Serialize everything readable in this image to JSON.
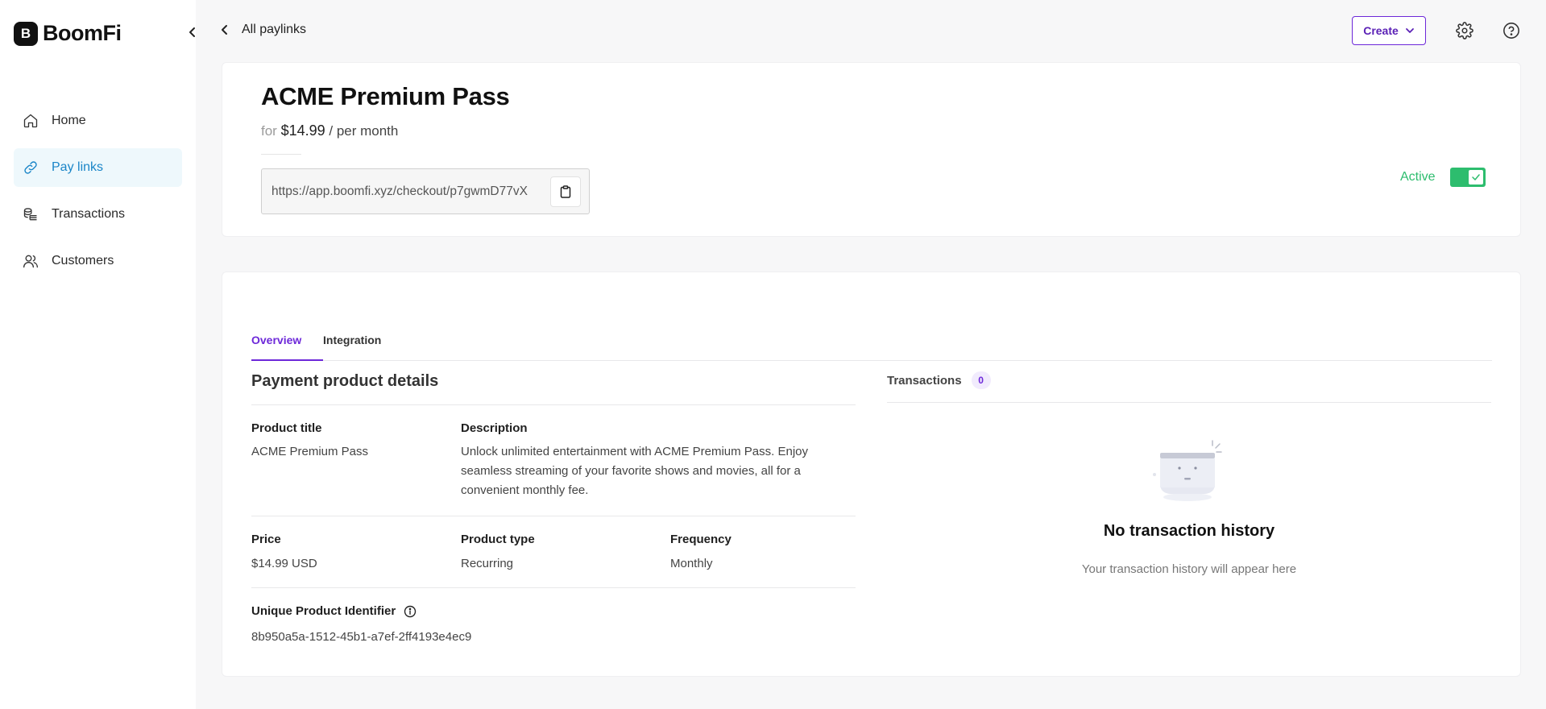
{
  "brand": {
    "logo_mark": "B",
    "name": "BoomFi"
  },
  "sidebar": {
    "items": [
      {
        "label": "Home",
        "icon": "home-icon",
        "active": false
      },
      {
        "label": "Pay links",
        "icon": "link-icon",
        "active": true
      },
      {
        "label": "Transactions",
        "icon": "coins-icon",
        "active": false
      },
      {
        "label": "Customers",
        "icon": "users-icon",
        "active": false
      }
    ]
  },
  "topbar": {
    "back_label": "All paylinks",
    "create_label": "Create"
  },
  "product": {
    "title": "ACME Premium Pass",
    "price_prefix": "for",
    "price": "$14.99",
    "period": "/ per month",
    "checkout_url": "https://app.boomfi.xyz/checkout/p7gwmD77vX",
    "status_label": "Active",
    "status_active": true
  },
  "tabs": [
    {
      "label": "Overview",
      "active": true
    },
    {
      "label": "Integration",
      "active": false
    }
  ],
  "details": {
    "section_title": "Payment product details",
    "product_title_label": "Product title",
    "product_title_value": "ACME Premium Pass",
    "description_label": "Description",
    "description_value": "Unlock unlimited entertainment with ACME Premium Pass. Enjoy seamless streaming of your favorite shows and movies, all for a convenient monthly fee.",
    "price_label": "Price",
    "price_value": "$14.99 USD",
    "type_label": "Product type",
    "type_value": "Recurring",
    "frequency_label": "Frequency",
    "frequency_value": "Monthly",
    "uid_label": "Unique Product Identifier",
    "uid_value": "8b950a5a-1512-45b1-a7ef-2ff4193e4ec9"
  },
  "transactions": {
    "label": "Transactions",
    "count": "0",
    "empty_title": "No transaction history",
    "empty_subtitle": "Your transaction history will appear here"
  },
  "colors": {
    "accent": "#6d28d9",
    "active_nav": "#1b86c8",
    "active_nav_bg": "#eef8fc",
    "success": "#2dbd6e"
  }
}
